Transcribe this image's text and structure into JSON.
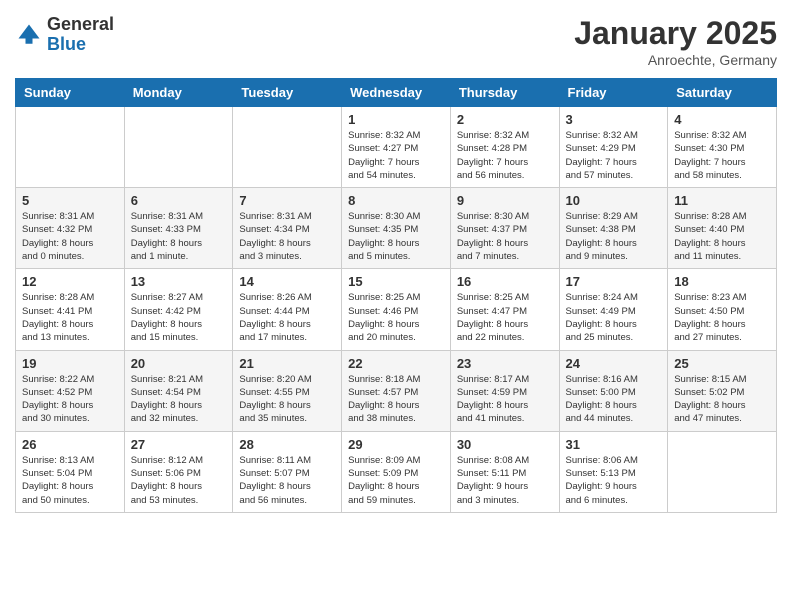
{
  "header": {
    "logo_line1": "General",
    "logo_line2": "Blue",
    "month_year": "January 2025",
    "location": "Anroechte, Germany"
  },
  "days_of_week": [
    "Sunday",
    "Monday",
    "Tuesday",
    "Wednesday",
    "Thursday",
    "Friday",
    "Saturday"
  ],
  "weeks": [
    [
      {
        "day": "",
        "info": ""
      },
      {
        "day": "",
        "info": ""
      },
      {
        "day": "",
        "info": ""
      },
      {
        "day": "1",
        "info": "Sunrise: 8:32 AM\nSunset: 4:27 PM\nDaylight: 7 hours\nand 54 minutes."
      },
      {
        "day": "2",
        "info": "Sunrise: 8:32 AM\nSunset: 4:28 PM\nDaylight: 7 hours\nand 56 minutes."
      },
      {
        "day": "3",
        "info": "Sunrise: 8:32 AM\nSunset: 4:29 PM\nDaylight: 7 hours\nand 57 minutes."
      },
      {
        "day": "4",
        "info": "Sunrise: 8:32 AM\nSunset: 4:30 PM\nDaylight: 7 hours\nand 58 minutes."
      }
    ],
    [
      {
        "day": "5",
        "info": "Sunrise: 8:31 AM\nSunset: 4:32 PM\nDaylight: 8 hours\nand 0 minutes."
      },
      {
        "day": "6",
        "info": "Sunrise: 8:31 AM\nSunset: 4:33 PM\nDaylight: 8 hours\nand 1 minute."
      },
      {
        "day": "7",
        "info": "Sunrise: 8:31 AM\nSunset: 4:34 PM\nDaylight: 8 hours\nand 3 minutes."
      },
      {
        "day": "8",
        "info": "Sunrise: 8:30 AM\nSunset: 4:35 PM\nDaylight: 8 hours\nand 5 minutes."
      },
      {
        "day": "9",
        "info": "Sunrise: 8:30 AM\nSunset: 4:37 PM\nDaylight: 8 hours\nand 7 minutes."
      },
      {
        "day": "10",
        "info": "Sunrise: 8:29 AM\nSunset: 4:38 PM\nDaylight: 8 hours\nand 9 minutes."
      },
      {
        "day": "11",
        "info": "Sunrise: 8:28 AM\nSunset: 4:40 PM\nDaylight: 8 hours\nand 11 minutes."
      }
    ],
    [
      {
        "day": "12",
        "info": "Sunrise: 8:28 AM\nSunset: 4:41 PM\nDaylight: 8 hours\nand 13 minutes."
      },
      {
        "day": "13",
        "info": "Sunrise: 8:27 AM\nSunset: 4:42 PM\nDaylight: 8 hours\nand 15 minutes."
      },
      {
        "day": "14",
        "info": "Sunrise: 8:26 AM\nSunset: 4:44 PM\nDaylight: 8 hours\nand 17 minutes."
      },
      {
        "day": "15",
        "info": "Sunrise: 8:25 AM\nSunset: 4:46 PM\nDaylight: 8 hours\nand 20 minutes."
      },
      {
        "day": "16",
        "info": "Sunrise: 8:25 AM\nSunset: 4:47 PM\nDaylight: 8 hours\nand 22 minutes."
      },
      {
        "day": "17",
        "info": "Sunrise: 8:24 AM\nSunset: 4:49 PM\nDaylight: 8 hours\nand 25 minutes."
      },
      {
        "day": "18",
        "info": "Sunrise: 8:23 AM\nSunset: 4:50 PM\nDaylight: 8 hours\nand 27 minutes."
      }
    ],
    [
      {
        "day": "19",
        "info": "Sunrise: 8:22 AM\nSunset: 4:52 PM\nDaylight: 8 hours\nand 30 minutes."
      },
      {
        "day": "20",
        "info": "Sunrise: 8:21 AM\nSunset: 4:54 PM\nDaylight: 8 hours\nand 32 minutes."
      },
      {
        "day": "21",
        "info": "Sunrise: 8:20 AM\nSunset: 4:55 PM\nDaylight: 8 hours\nand 35 minutes."
      },
      {
        "day": "22",
        "info": "Sunrise: 8:18 AM\nSunset: 4:57 PM\nDaylight: 8 hours\nand 38 minutes."
      },
      {
        "day": "23",
        "info": "Sunrise: 8:17 AM\nSunset: 4:59 PM\nDaylight: 8 hours\nand 41 minutes."
      },
      {
        "day": "24",
        "info": "Sunrise: 8:16 AM\nSunset: 5:00 PM\nDaylight: 8 hours\nand 44 minutes."
      },
      {
        "day": "25",
        "info": "Sunrise: 8:15 AM\nSunset: 5:02 PM\nDaylight: 8 hours\nand 47 minutes."
      }
    ],
    [
      {
        "day": "26",
        "info": "Sunrise: 8:13 AM\nSunset: 5:04 PM\nDaylight: 8 hours\nand 50 minutes."
      },
      {
        "day": "27",
        "info": "Sunrise: 8:12 AM\nSunset: 5:06 PM\nDaylight: 8 hours\nand 53 minutes."
      },
      {
        "day": "28",
        "info": "Sunrise: 8:11 AM\nSunset: 5:07 PM\nDaylight: 8 hours\nand 56 minutes."
      },
      {
        "day": "29",
        "info": "Sunrise: 8:09 AM\nSunset: 5:09 PM\nDaylight: 8 hours\nand 59 minutes."
      },
      {
        "day": "30",
        "info": "Sunrise: 8:08 AM\nSunset: 5:11 PM\nDaylight: 9 hours\nand 3 minutes."
      },
      {
        "day": "31",
        "info": "Sunrise: 8:06 AM\nSunset: 5:13 PM\nDaylight: 9 hours\nand 6 minutes."
      },
      {
        "day": "",
        "info": ""
      }
    ]
  ]
}
